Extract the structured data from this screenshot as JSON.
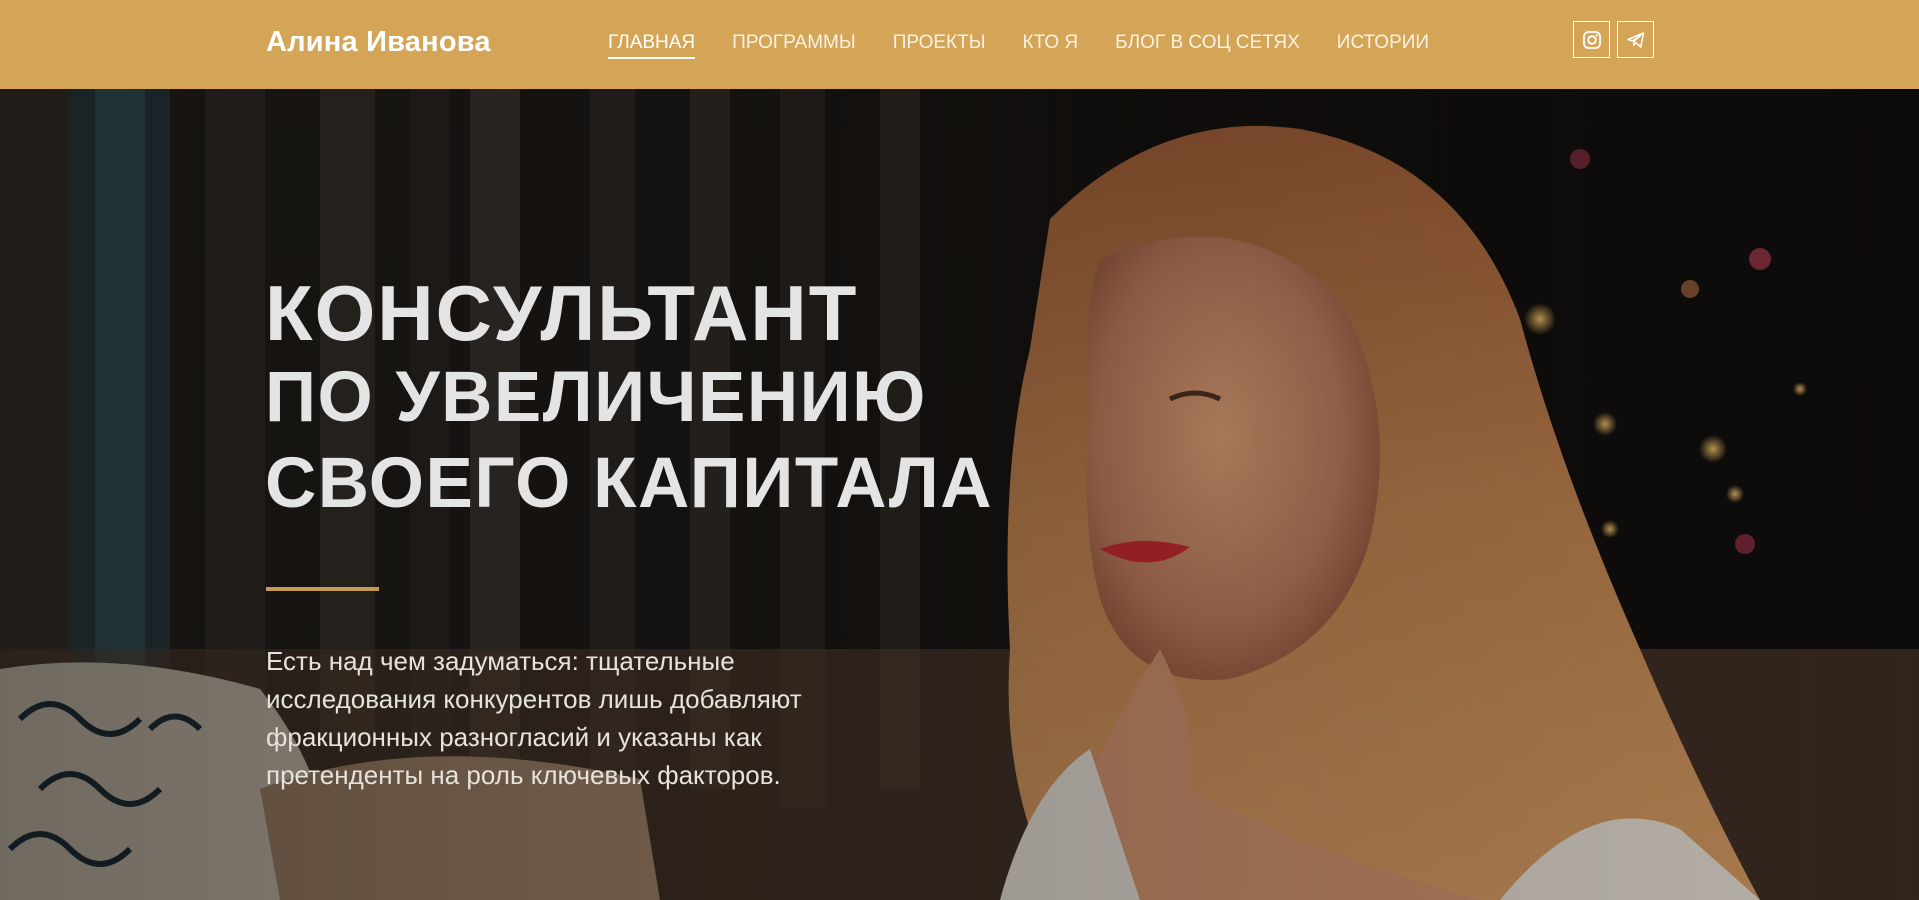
{
  "header": {
    "brand": "Алина Иванова",
    "nav": [
      {
        "label": "ГЛАВНАЯ",
        "active": true
      },
      {
        "label": "ПРОГРАММЫ",
        "active": false
      },
      {
        "label": "ПРОЕКТЫ",
        "active": false
      },
      {
        "label": "КТО Я",
        "active": false
      },
      {
        "label": "БЛОГ В СОЦ СЕТЯХ",
        "active": false
      },
      {
        "label": "ИСТОРИИ",
        "active": false
      }
    ],
    "social": [
      {
        "icon": "instagram-icon"
      },
      {
        "icon": "telegram-icon"
      }
    ],
    "bg_color": "#d4a557"
  },
  "hero": {
    "title_line1": "КОНСУЛЬТАНТ",
    "title_line2": "ПО УВЕЛИЧЕНИЮ",
    "title_line3": "СВОЕГО КАПИТАЛА",
    "description": "Есть над чем задуматься: тщательные исследования конкурентов лишь добавляют фракционных разногласий и указаны как претенденты на роль ключевых факторов.",
    "accent_color": "#c49a55"
  }
}
